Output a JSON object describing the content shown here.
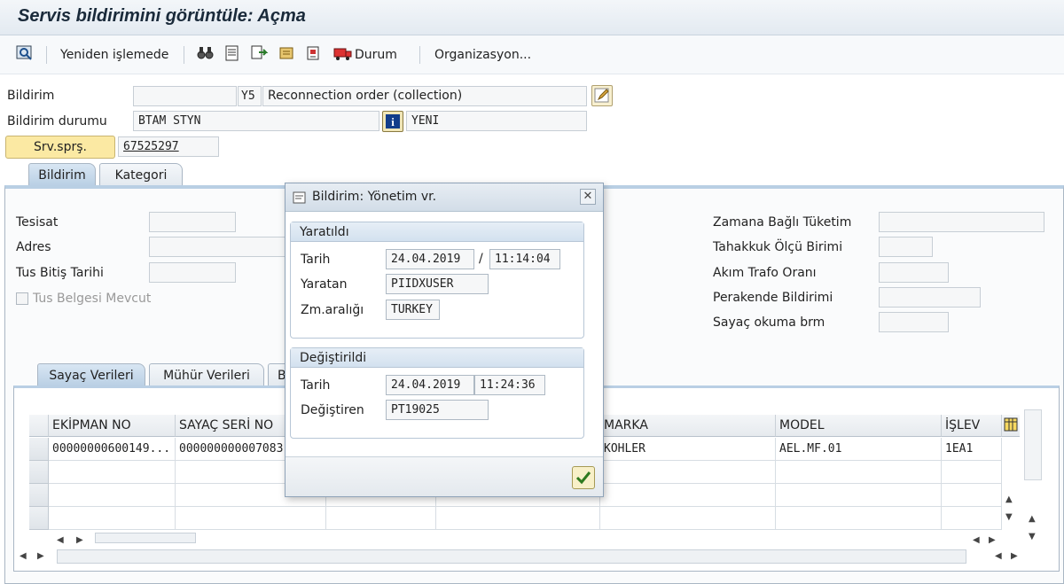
{
  "window_title": "Servis bildirimini görüntüle: Açma",
  "toolbar": {
    "reprocess_label": "Yeniden işlemede",
    "status_label": "Durum",
    "organization_label": "Organizasyon..."
  },
  "header": {
    "notification_label": "Bildirim",
    "notification_value": "",
    "notification_type": "Y5",
    "notification_desc": "Reconnection order (collection)",
    "status_label": "Bildirim durumu",
    "status_value": "BTAM STYN",
    "status_user": "YENI",
    "service_order_button": "Srv.sprş.",
    "service_order_value": "67525297"
  },
  "tabs": {
    "main": [
      "Bildirim",
      "Kategori"
    ],
    "sub": [
      "Sayaç Verileri",
      "Mühür Verileri",
      "B"
    ]
  },
  "left_fields": {
    "facility": "Tesisat",
    "address": "Adres",
    "tus_end_date": "Tus Bitiş Tarihi",
    "tus_doc_checkbox": "Tus Belgesi Mevcut"
  },
  "right_fields": {
    "time_dependent": "Zamana Bağlı Tüketim",
    "accrual_unit": "Tahakkuk Ölçü Birimi",
    "ct_ratio": "Akım Trafo Oranı",
    "retail_notification": "Perakende Bildirimi",
    "meter_reading_unit": "Sayaç okuma brm"
  },
  "grid": {
    "columns": [
      "EKİPMAN NO",
      "SAYAÇ SERİ NO",
      "MARKA",
      "MODEL",
      "İŞLEV"
    ],
    "rows": [
      [
        "00000000600149...",
        "000000000007083",
        "KOHLER",
        "AEL.MF.01",
        "1EA1"
      ]
    ]
  },
  "dialog": {
    "title": "Bildirim: Yönetim vr.",
    "created_group": "Yaratıldı",
    "date_label": "Tarih",
    "created_date": "24.04.2019",
    "separator": "/",
    "created_time": "11:14:04",
    "creator_label": "Yaratan",
    "creator_value": "PIIDXUSER",
    "timezone_label": "Zm.aralığı",
    "timezone_value": "TURKEY",
    "changed_group": "Değiştirildi",
    "changed_date": "24.04.2019",
    "changed_time": "11:24:36",
    "changer_label": "Değiştiren",
    "changer_value": "PT19025"
  },
  "colors": {
    "accent_button": "#fbe9a3",
    "tab_active": "#c5d8ec",
    "title_text": "#1a2a3a"
  },
  "icons": [
    "zoom-icon",
    "binoculars-icon",
    "document-icon",
    "transfer-icon",
    "scroll-icon",
    "display-icon",
    "truck-icon",
    "edit-icon",
    "info-icon",
    "close-icon",
    "checkmark-icon",
    "layout-icon"
  ]
}
